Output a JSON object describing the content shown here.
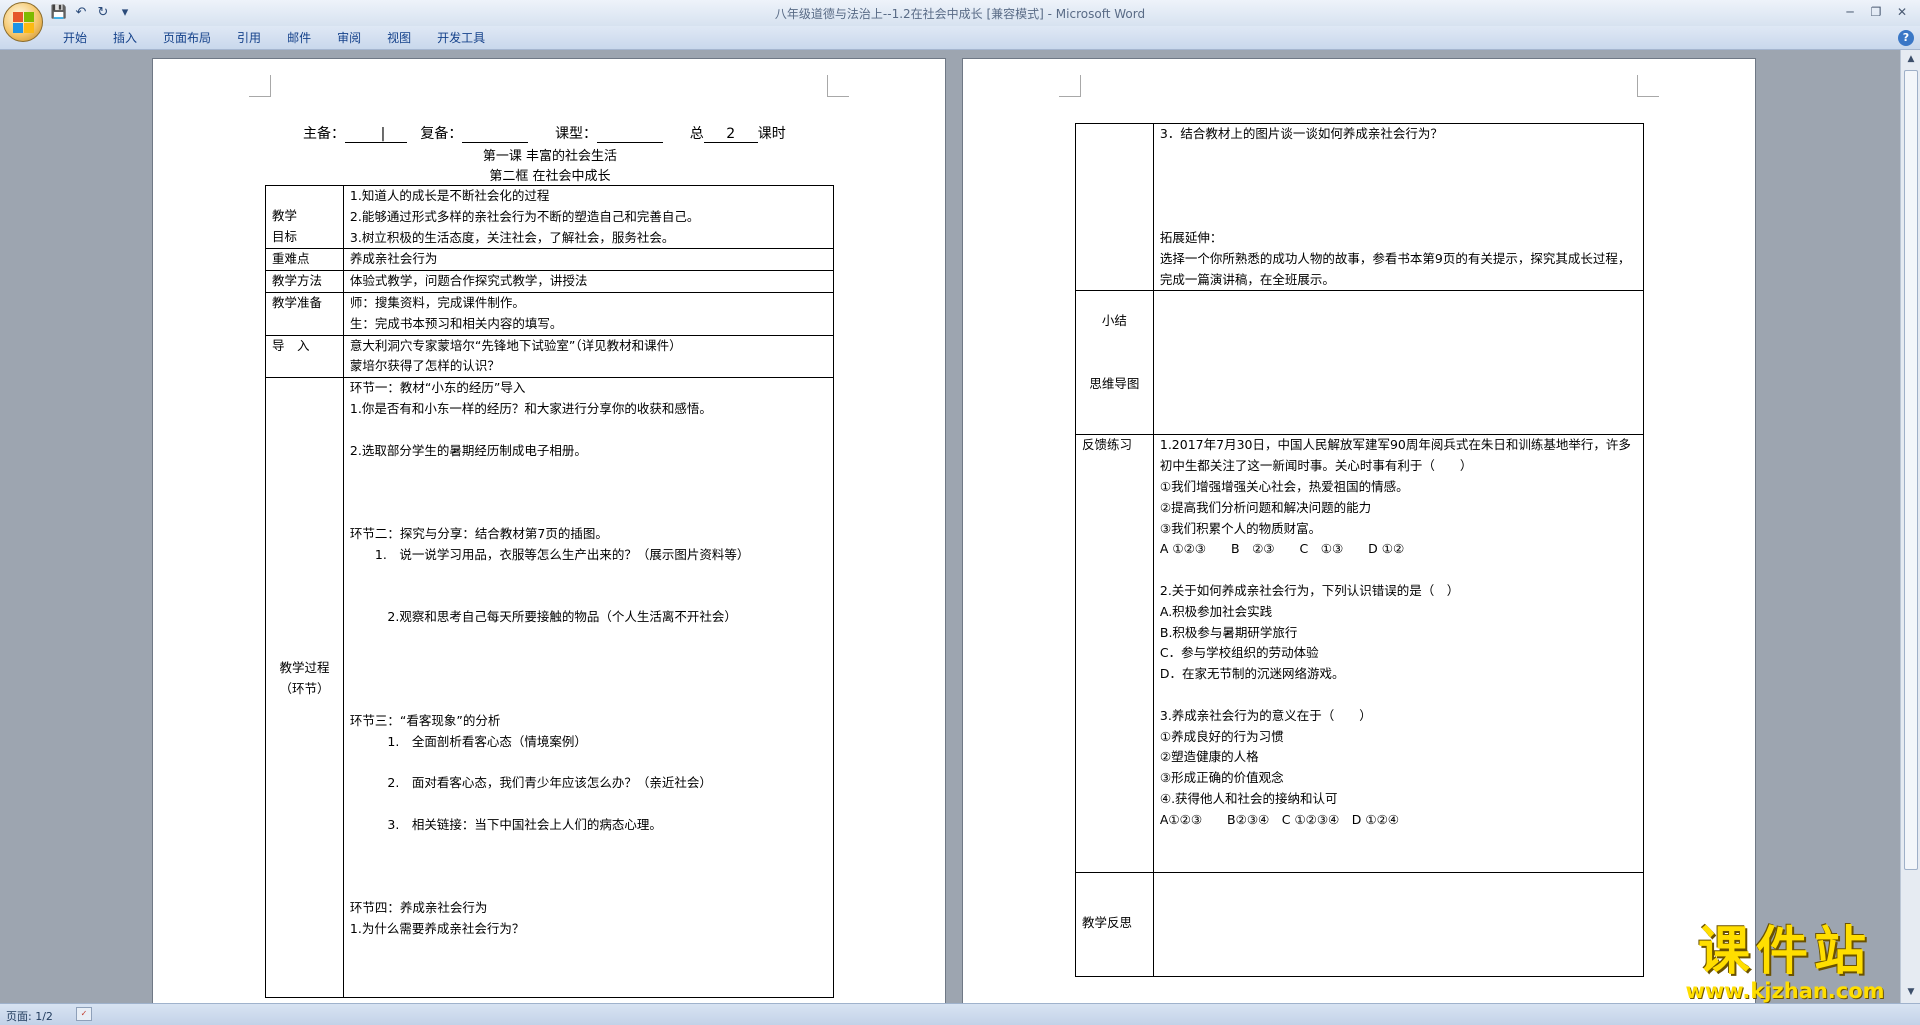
{
  "window": {
    "title": "八年级道德与法治上--1.2在社会中成长 [兼容模式] - Microsoft Word"
  },
  "qat": {
    "save": "💾",
    "undo": "↶",
    "redo": "↻",
    "more": "▾"
  },
  "ribbon": {
    "tabs": [
      "开始",
      "插入",
      "页面布局",
      "引用",
      "邮件",
      "审阅",
      "视图",
      "开发工具"
    ]
  },
  "status": {
    "page": "页面: 1/2"
  },
  "watermark": {
    "line1": "课件站",
    "line2": "www.kjzhan.com"
  },
  "page1": {
    "header": {
      "zhubei": "主备：",
      "fubei": "复备：",
      "kexing": "课型：",
      "zong": "总",
      "num": "2",
      "keshi": "课时"
    },
    "title1": "第一课 丰富的社会生活",
    "title2": "第二框 在社会中成长",
    "rows": {
      "goal_label": "教学\n目标",
      "goals": [
        "1.知道人的成长是不断社会化的过程",
        "2.能够通过形式多样的亲社会行为不断的塑造自己和完善自己。",
        "3.树立积极的生活态度，关注社会，了解社会，服务社会。"
      ],
      "key_label": "重难点",
      "key": "养成亲社会行为",
      "method_label": "教学方法",
      "method": "体验式教学，问题合作探究式教学，讲授法",
      "prep_label": "教学准备",
      "prep": [
        "师：搜集资料，完成课件制作。",
        "生：完成书本预习和相关内容的填写。"
      ],
      "intro_label": "导　入",
      "intro": [
        "意大利洞穴专家蒙培尔“先锋地下试验室”（详见教材和课件）",
        "蒙培尔获得了怎样的认识？"
      ],
      "process_label": "教学过程\n（环节）",
      "process": [
        "环节一：教材“小东的经历”导入",
        "1.你是否有和小东一样的经历？和大家进行分享你的收获和感悟。",
        "",
        "2.选取部分学生的暑期经历制成电子相册。",
        "",
        "",
        "",
        "环节二：探究与分享：结合教材第7页的插图。",
        "　　1.　说一说学习用品，衣服等怎么生产出来的？（展示图片资料等）",
        "",
        "",
        "　　　2.观察和思考自己每天所要接触的物品（个人生活离不开社会）",
        "",
        "",
        "",
        "",
        "环节三：“看客现象”的分析",
        "　　　1.　全面剖析看客心态（情境案例）",
        "",
        "　　　2.　面对看客心态，我们青少年应该怎么办？（亲近社会）",
        "",
        "　　　3.　相关链接：当下中国社会上人们的病态心理。",
        "",
        "",
        "",
        "环节四：养成亲社会行为",
        "1.为什么需要养成亲社会行为？"
      ]
    }
  },
  "page2": {
    "cont": [
      "3．结合教材上的图片谈一谈如何养成亲社会行为？",
      "",
      "",
      "",
      "",
      "拓展延伸：",
      "选择一个你所熟悉的成功人物的故事，参看书本第9页的有关提示，探究其成长过程，完成一篇演讲稿，在全班展示。"
    ],
    "summary_label": "小结\n\n\n思维导图",
    "feedback_label": "反馈练习",
    "feedback": [
      "1.2017年7月30日，中国人民解放军建军90周年阅兵式在朱日和训练基地举行，许多初中生都关注了这一新闻时事。关心时事有利于（　　）",
      "①我们增强增强关心社会，热爱祖国的情感。",
      "②提高我们分析问题和解决问题的能力",
      "③我们积累个人的物质财富。",
      "A ①②③　　B　②③　　C　①③　　D ①②",
      "",
      "2.关于如何养成亲社会行为，下列认识错误的是（　）",
      " A.积极参加社会实践",
      " B.积极参与暑期研学旅行",
      " C．参与学校组织的劳动体验",
      " D．在家无节制的沉迷网络游戏。",
      "",
      "3.养成亲社会行为的意义在于（　　）",
      "①养成良好的行为习惯",
      "②塑造健康的人格",
      "③形成正确的价值观念",
      "④.获得他人和社会的接纳和认可",
      "A①②③　　B②③④　C ①②③④　D ①②④",
      "",
      ""
    ],
    "reflect_label": "教学反思"
  }
}
